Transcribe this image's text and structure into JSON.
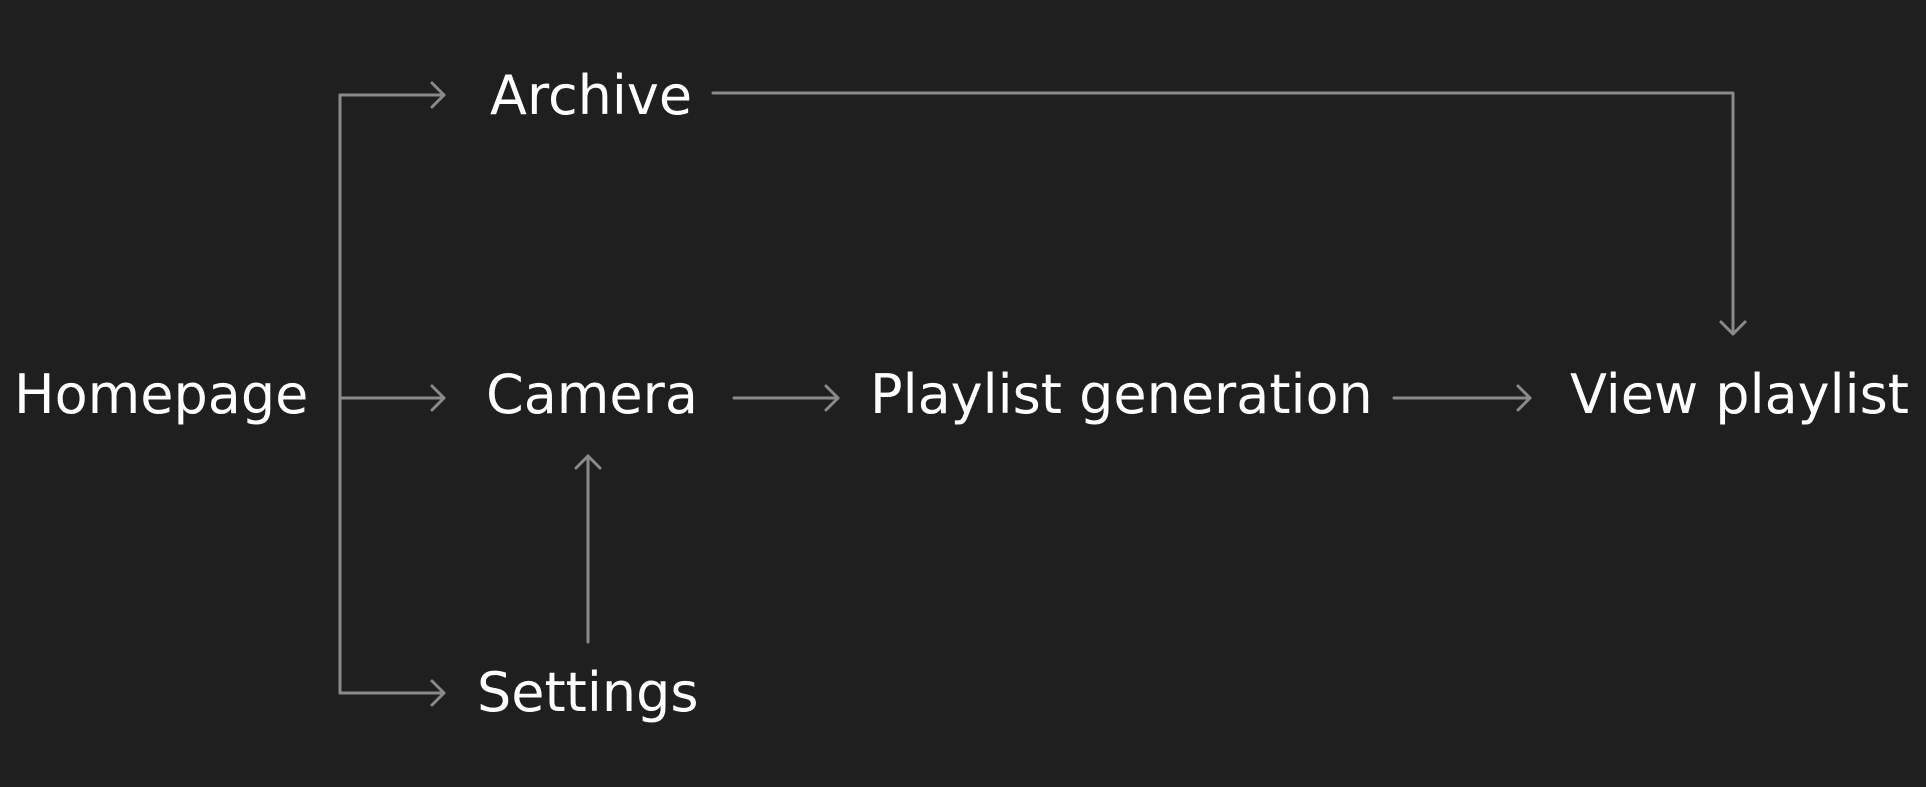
{
  "diagram": {
    "background": "#1f1f1f",
    "line_color": "#8a8a8a",
    "text_color": "#ffffff",
    "nodes": {
      "homepage": "Homepage",
      "archive": "Archive",
      "camera": "Camera",
      "settings": "Settings",
      "playlist_generation": "Playlist generation",
      "view_playlist": "View playlist"
    },
    "edges": [
      {
        "from": "homepage",
        "to": "archive"
      },
      {
        "from": "homepage",
        "to": "camera"
      },
      {
        "from": "homepage",
        "to": "settings"
      },
      {
        "from": "settings",
        "to": "camera"
      },
      {
        "from": "camera",
        "to": "playlist_generation"
      },
      {
        "from": "playlist_generation",
        "to": "view_playlist"
      },
      {
        "from": "archive",
        "to": "view_playlist"
      }
    ]
  }
}
